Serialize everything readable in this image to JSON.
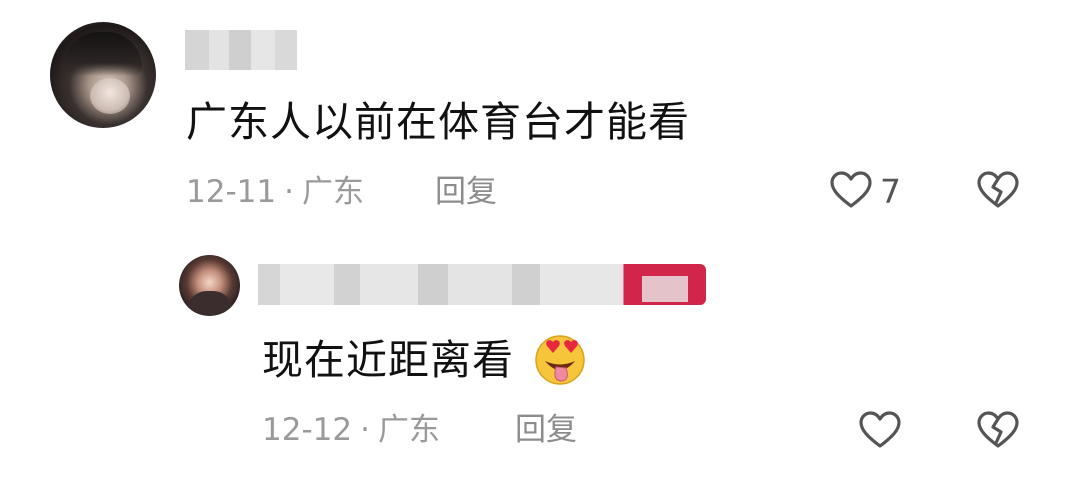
{
  "comments": [
    {
      "text": "广东人以前在体育台才能看",
      "date": "12-11",
      "separator": "·",
      "location": "广东",
      "reply_label": "回复",
      "likes": "7"
    },
    {
      "text": "现在近距离看",
      "emoji": "heart-eyes-tongue-emoji",
      "date": "12-12",
      "separator": "·",
      "location": "广东",
      "reply_label": "回复"
    }
  ],
  "colors": {
    "text": "#111111",
    "meta": "#9a9a9a",
    "icon": "#555555",
    "badge": "#d2254a"
  },
  "icons": [
    "heart-outline-icon",
    "broken-heart-icon"
  ]
}
